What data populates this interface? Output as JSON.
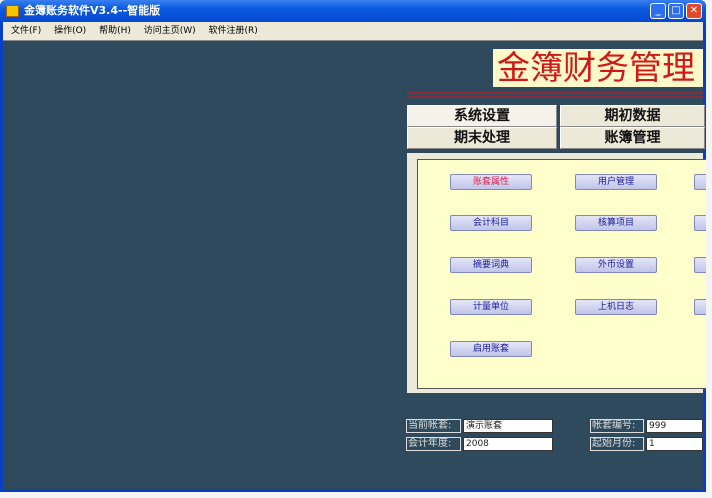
{
  "window": {
    "title": "金簿账务软件V3.4--智能版",
    "icon_label": "金簿",
    "minimize": "_",
    "maximize": "□",
    "close": "✕"
  },
  "menu": [
    "文件(F)",
    "操作(O)",
    "帮助(H)",
    "访问主页(W)",
    "软件注册(R)"
  ],
  "banner": "金簿财务管理",
  "tabs": [
    "系统设置",
    "期初数据",
    "期末处理",
    "账簿管理"
  ],
  "buttons": [
    [
      "账套属性",
      "用户管理"
    ],
    [
      "会计科目",
      "核算项目"
    ],
    [
      "摘要词典",
      "外币设置"
    ],
    [
      "计量单位",
      "上机日志"
    ],
    [
      "启用账套"
    ]
  ],
  "info": {
    "current_set_label": "当前帐套:",
    "current_set": "演示账套",
    "year_label": "会计年度:",
    "year": "2008",
    "set_no_label": "帐套编号:",
    "set_no": "999",
    "start_month_label": "起始月份:",
    "start_month": "1"
  }
}
